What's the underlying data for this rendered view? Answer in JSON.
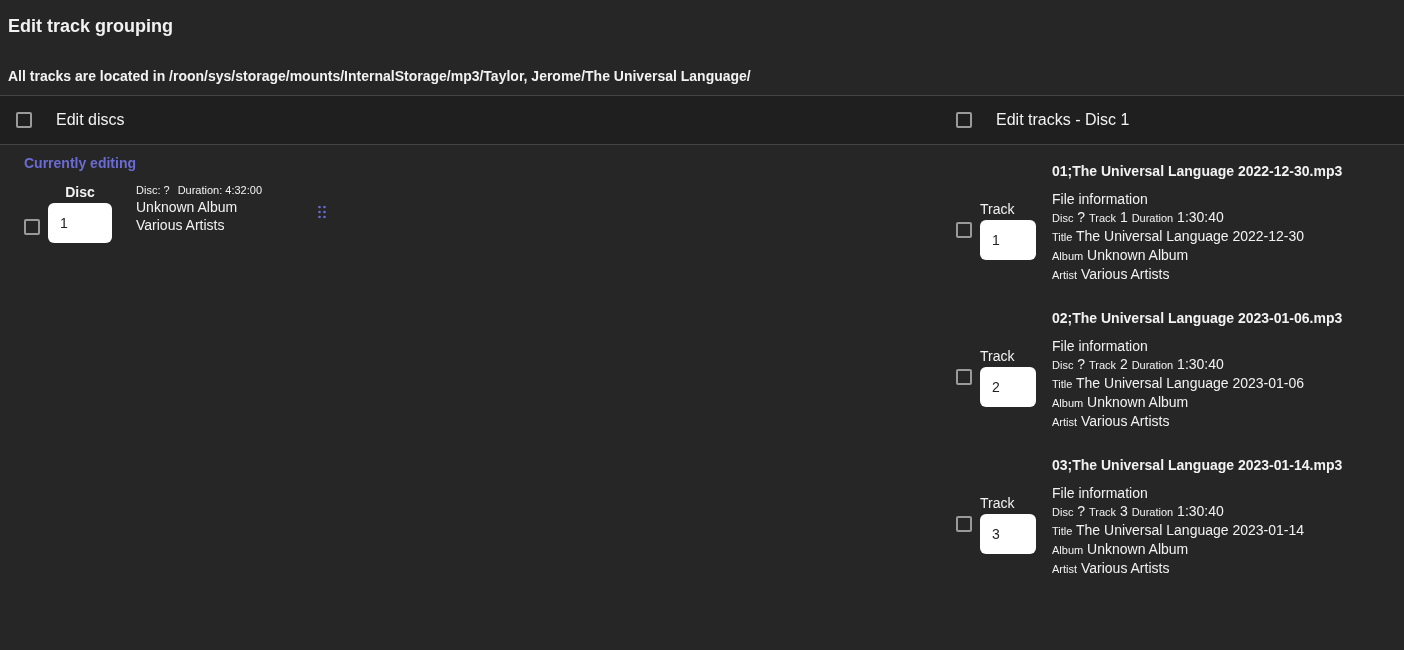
{
  "title": "Edit track grouping",
  "location_note": "All tracks are located in /roon/sys/storage/mounts/InternalStorage/mp3/Taylor, Jerome/The Universal Language/",
  "discs_panel": {
    "header_label": "Edit discs",
    "checked": false,
    "section_label": "Currently editing",
    "discs": [
      {
        "checked": false,
        "field_label": "Disc",
        "value": "1",
        "meta": [
          "Disc: ?",
          "Duration: 4:32:00"
        ],
        "album": "Unknown Album",
        "artist": "Various Artists"
      }
    ]
  },
  "tracks_panel": {
    "header_label": "Edit tracks - Disc 1",
    "checked": false,
    "tracks": [
      {
        "filename": "01;The Universal Language 2022-12-30.mp3",
        "checked": false,
        "field_label": "Track",
        "value": "1",
        "info_heading": "File information",
        "info_lines": [
          [
            {
              "label": "Disc",
              "value": "?"
            },
            {
              "label": "Track",
              "value": "1"
            },
            {
              "label": "Duration",
              "value": "1:30:40"
            }
          ],
          [
            {
              "label": "Title",
              "value": "The Universal Language 2022-12-30"
            }
          ],
          [
            {
              "label": "Album",
              "value": "Unknown Album"
            }
          ],
          [
            {
              "label": "Artist",
              "value": "Various Artists"
            }
          ]
        ]
      },
      {
        "filename": "02;The Universal Language 2023-01-06.mp3",
        "checked": false,
        "field_label": "Track",
        "value": "2",
        "info_heading": "File information",
        "info_lines": [
          [
            {
              "label": "Disc",
              "value": "?"
            },
            {
              "label": "Track",
              "value": "2"
            },
            {
              "label": "Duration",
              "value": "1:30:40"
            }
          ],
          [
            {
              "label": "Title",
              "value": "The Universal Language 2023-01-06"
            }
          ],
          [
            {
              "label": "Album",
              "value": "Unknown Album"
            }
          ],
          [
            {
              "label": "Artist",
              "value": "Various Artists"
            }
          ]
        ]
      },
      {
        "filename": "03;The Universal Language 2023-01-14.mp3",
        "checked": false,
        "field_label": "Track",
        "value": "3",
        "info_heading": "File information",
        "info_lines": [
          [
            {
              "label": "Disc",
              "value": "?"
            },
            {
              "label": "Track",
              "value": "3"
            },
            {
              "label": "Duration",
              "value": "1:30:40"
            }
          ],
          [
            {
              "label": "Title",
              "value": "The Universal Language 2023-01-14"
            }
          ],
          [
            {
              "label": "Album",
              "value": "Unknown Album"
            }
          ],
          [
            {
              "label": "Artist",
              "value": "Various Artists"
            }
          ]
        ]
      }
    ]
  }
}
